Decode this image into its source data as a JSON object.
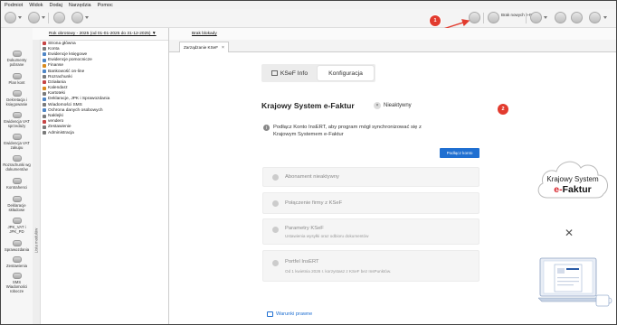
{
  "menu": [
    "Podmiot",
    "Widok",
    "Dodaj",
    "Narzędzia",
    "Pomoc"
  ],
  "toolbar": {
    "new_ereceipt_label": "Brak nowych\ne-Faktur"
  },
  "leftnav": [
    {
      "label": "Dokumenty\npobrane"
    },
    {
      "label": "Plan kont"
    },
    {
      "label": "Dekretacja i\nksięgowanie"
    },
    {
      "label": "Ewidencja VAT\nsprzedaży"
    },
    {
      "label": "Ewidencja VAT\nzakupu"
    },
    {
      "label": "Rozrachunki wg\ndokumentów"
    },
    {
      "label": "Kontrahenci"
    },
    {
      "label": "Deklaracje\nskładowe"
    },
    {
      "label": "JPK_VAT i\nJPK_PD"
    },
    {
      "label": "Sprawozdania"
    },
    {
      "label": "Zestawienia"
    },
    {
      "label": "SMS\nWiadomości\nrobocze"
    }
  ],
  "period": "Rok obrotowy - 2025 (od 01-01-2025 do 31-12-2025) ▼",
  "vertical_tab": "Lista modułów",
  "tree": [
    {
      "label": "Strona główna",
      "color": "#c64545"
    },
    {
      "label": "Konta",
      "color": "#7a7a7a"
    },
    {
      "label": "Ewidencje księgowe",
      "color": "#4f86c6"
    },
    {
      "label": "Ewidencje pomocnicze",
      "color": "#4f86c6"
    },
    {
      "label": "Finanse",
      "color": "#d98b1f"
    },
    {
      "label": "Bankowość on-line",
      "color": "#4f86c6"
    },
    {
      "label": "Rozrachunki",
      "color": "#7a7a7a"
    },
    {
      "label": "Działania",
      "color": "#c64545"
    },
    {
      "label": "Kalendarz",
      "color": "#d98b1f"
    },
    {
      "label": "Kartoteki",
      "color": "#7a7a7a"
    },
    {
      "label": "Deklaracje, JPK i Sprawozdania",
      "color": "#4f86c6"
    },
    {
      "label": "Wiadomości SMS",
      "color": "#7a7a7a"
    },
    {
      "label": "Ochrona danych osobowych",
      "color": "#4f86c6"
    },
    {
      "label": "Naklejki",
      "color": "#7a7a7a"
    },
    {
      "label": "vendero",
      "color": "#c64545"
    },
    {
      "label": "Zestawienie",
      "color": "#7a7a7a"
    },
    {
      "label": "Administracja",
      "color": "#7a7a7a"
    }
  ],
  "main": {
    "no_data": "Brak blokady",
    "tab": "Zarządzanie KSeF",
    "segments": [
      "KSeF Info",
      "Konfiguracja"
    ],
    "title": "Krajowy System e-Faktur",
    "status": "Nieaktywny",
    "info": "Podłącz Konto InsERT, aby program mógł synchronizować się z Krajowym Systemem e-Faktur",
    "connect_button": "Podłącz konto",
    "cards": [
      {
        "title": "Abonament nieaktywny",
        "subtitle": ""
      },
      {
        "title": "Połączenie firmy z KSeF",
        "subtitle": ""
      },
      {
        "title": "Parametry KSeF",
        "subtitle": "Ustawienia wysyłki oraz odbioru dokumentów"
      },
      {
        "title": "Portfel InsERT",
        "subtitle": "Od 1 kwietnia 2026 r. korzystasz z KSeF bez InsPunktów."
      }
    ],
    "terms": "Warunki prawne"
  },
  "logo": {
    "line1": "Krajowy System",
    "brand_e": "e-",
    "brand_rest": "Faktur"
  },
  "callouts": [
    "1",
    "2"
  ],
  "colors": {
    "accent": "#1f6fd1",
    "callout": "#e23b2e"
  }
}
